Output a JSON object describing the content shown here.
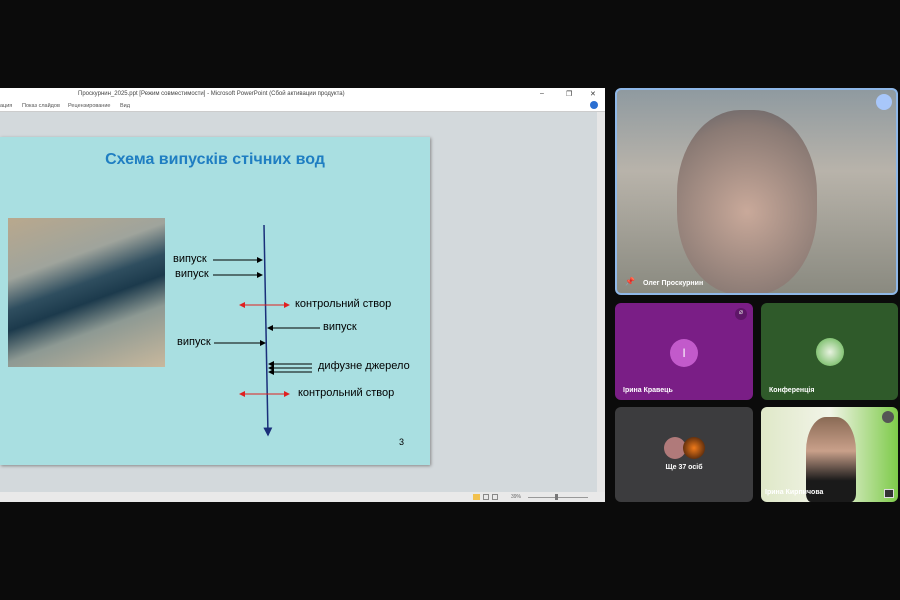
{
  "window": {
    "title": "Проскурнин_2025.ppt [Режим совместимости] - Microsoft PowerPoint (Сбой активации продукта)",
    "minimize": "–",
    "maximize": "❐",
    "close": "✕"
  },
  "ribbon": {
    "tabs": [
      "ация",
      "Показ слайдов",
      "Рецензирование",
      "Вид"
    ]
  },
  "status": {
    "zoom": "39%"
  },
  "slide": {
    "title": "Схема випусків стічних вод",
    "labels": {
      "outlet1": "випуск",
      "outlet2": "випуск",
      "control1": "контрольний створ",
      "outlet3": "випуск",
      "outlet4": "випуск",
      "diffuse": "дифузне джерело",
      "control2": "контрольний створ"
    },
    "page_number": "3"
  },
  "participants": {
    "main": {
      "name": "Олег Проскурнин"
    },
    "tile1": {
      "name": "Ірина Кравець",
      "initial": "I",
      "color": "#7a1e86"
    },
    "tile2": {
      "name": "Конференція",
      "color": "#2f5a2a"
    },
    "tile3": {
      "more": "Ще 37 осіб"
    },
    "tile4": {
      "name": "Ірина Кирпичова"
    }
  }
}
